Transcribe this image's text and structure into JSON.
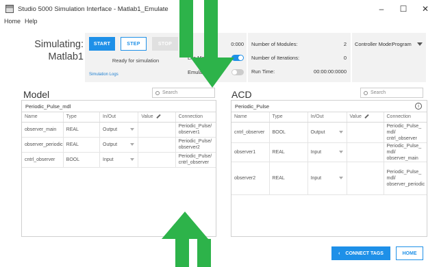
{
  "window": {
    "title": "Studio 5000 Simulation Interface - Matlab1_Emulate",
    "controls": [
      "–",
      "☐",
      "✕"
    ]
  },
  "menu": [
    "Home",
    "Help"
  ],
  "simulating": {
    "title": "Simulating: Matlab1",
    "start": "START",
    "step": "STEP",
    "stop": "STOP",
    "status": "Ready for simulation",
    "logs": "Simulation Logs",
    "time": "0:000",
    "lite_mode": "Lite Mode:",
    "emulate_ots": "Emulate OTS:",
    "lite_mode_on": true,
    "emulate_ots_on": false
  },
  "stats": {
    "modules_label": "Number of Modules:",
    "modules_value": "2",
    "iterations_label": "Number of Iterations:",
    "iterations_value": "0",
    "runtime_label": "Run Time:",
    "runtime_value": "00:00:00:0000"
  },
  "controller": {
    "label": "Controller Mode:",
    "value": "Program"
  },
  "model": {
    "title": "Model",
    "search_placeholder": "Search",
    "subtitle": "Periodic_Pulse_mdl",
    "columns": [
      "Name",
      "Type",
      "In/Out",
      "Value",
      "Connection"
    ],
    "rows": [
      {
        "name": "observer_main",
        "type": "REAL",
        "inout": "Output",
        "value": "",
        "connection": "Periodic_Pulse/ observer1"
      },
      {
        "name": "observer_periodic",
        "type": "REAL",
        "inout": "Output",
        "value": "",
        "connection": "Periodic_Pulse/ observer2"
      },
      {
        "name": "cntrl_observer",
        "type": "BOOL",
        "inout": "Input",
        "value": "",
        "connection": "Periodic_Pulse/ cntrl_observer"
      }
    ]
  },
  "acd": {
    "title": "ACD",
    "search_placeholder": "Search",
    "subtitle": "Periodic_Pulse",
    "columns": [
      "Name",
      "Type",
      "In/Out",
      "Value",
      "Connection"
    ],
    "rows": [
      {
        "name": "cntrl_observer",
        "type": "BOOL",
        "inout": "Output",
        "value": "",
        "connection": "Periodic_Pulse_ mdl/ cntrl_observer"
      },
      {
        "name": "observer1",
        "type": "REAL",
        "inout": "Input",
        "value": "",
        "connection": "Periodic_Pulse_ mdl/ observer_main"
      },
      {
        "name": "observer2",
        "type": "REAL",
        "inout": "Input",
        "value": "",
        "connection": "Periodic_Pulse_ mdl/ observer_periodic"
      }
    ]
  },
  "footer": {
    "connect_tags": "CONNECT TAGS",
    "home": "HOME"
  },
  "colors": {
    "accent": "#1e90e8",
    "arrow": "#2db34a"
  }
}
